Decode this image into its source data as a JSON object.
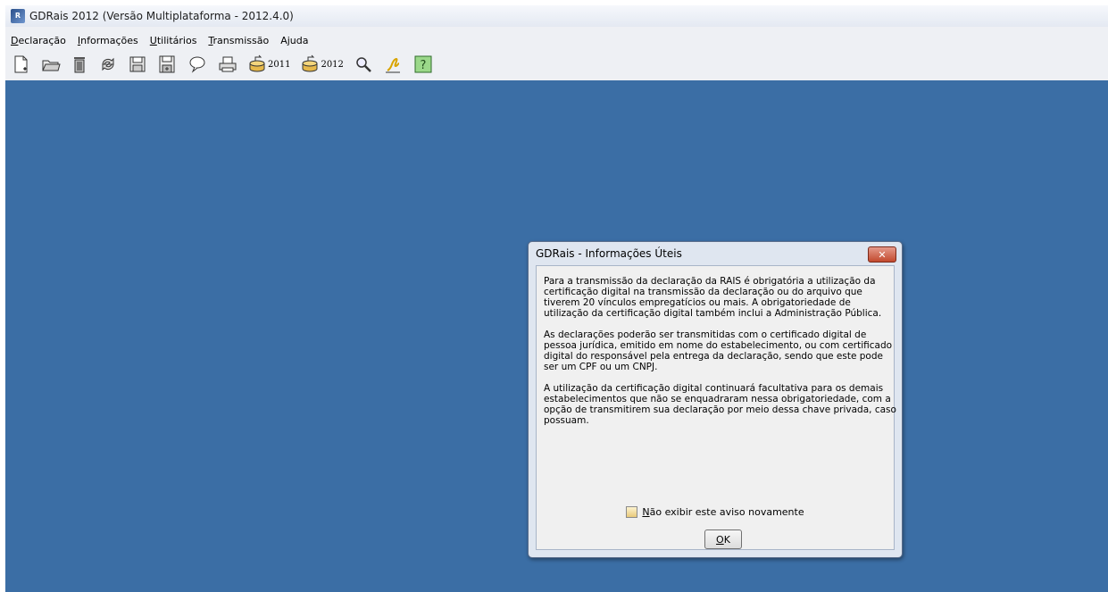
{
  "window": {
    "title": "GDRais 2012 (Versão Multiplataforma - 2012.4.0)",
    "icon": "gdrais-app-icon"
  },
  "menu": {
    "items": [
      {
        "underline": "D",
        "rest": "eclaração"
      },
      {
        "underline": "I",
        "rest": "nformações"
      },
      {
        "underline": "U",
        "rest": "tilitários"
      },
      {
        "underline": "T",
        "rest": "ransmissão"
      },
      {
        "pre": "A",
        "underline": "j",
        "rest": "uda"
      }
    ]
  },
  "toolbar": {
    "icons": [
      "new-document-icon",
      "open-folder-icon",
      "trash-icon",
      "refresh-icon",
      "save-icon",
      "save-as-icon",
      "comment-icon",
      "print-icon",
      "import-2011-icon",
      "import-2012-icon",
      "search-icon",
      "sign-icon",
      "help-icon"
    ],
    "label_2011": "2011",
    "label_2012": "2012"
  },
  "dialog": {
    "title": "GDRais - Informações Úteis",
    "close_label": "✕",
    "paragraphs": [
      "Para a transmissão da declaração da RAIS é obrigatória a utilização da certificação digital na transmissão da declaração ou do arquivo que tiverem 20 vínculos empregatícios ou mais. A obrigatoriedade de utilização da certificação digital também inclui a Administração Pública.",
      "As declarações poderão ser transmitidas com o certificado digital de pessoa jurídica, emitido em nome do estabelecimento, ou com certificado digital do responsável pela entrega da declaração, sendo que este pode ser um CPF ou um CNPJ.",
      "A utilização da certificação digital continuará facultativa para os demais estabelecimentos que não se enquadraram nessa obrigatoriedade, com a opção de transmitirem sua declaração por meio dessa chave privada, caso possuam."
    ],
    "checkbox": {
      "underline": "N",
      "rest": "ão exibir este aviso novamente",
      "checked": false
    },
    "ok": {
      "underline": "O",
      "rest": "K"
    }
  },
  "colors": {
    "desktop": "#3b6ea5",
    "dialog_frame": "#dfe6f0",
    "close_button": "#c24a2e"
  }
}
